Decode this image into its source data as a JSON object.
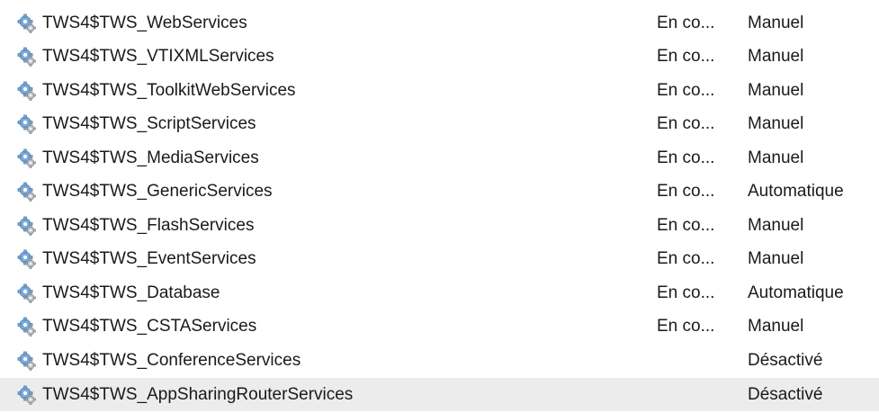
{
  "services": {
    "rows": [
      {
        "name": "TWS4$TWS_WebServices",
        "status": "En co...",
        "startup": "Manuel",
        "icon": "service-gear-icon"
      },
      {
        "name": "TWS4$TWS_VTIXMLServices",
        "status": "En co...",
        "startup": "Manuel",
        "icon": "service-gear-icon"
      },
      {
        "name": "TWS4$TWS_ToolkitWebServices",
        "status": "En co...",
        "startup": "Manuel",
        "icon": "service-gear-icon"
      },
      {
        "name": "TWS4$TWS_ScriptServices",
        "status": "En co...",
        "startup": "Manuel",
        "icon": "service-gear-icon"
      },
      {
        "name": "TWS4$TWS_MediaServices",
        "status": "En co...",
        "startup": "Manuel",
        "icon": "service-gear-icon"
      },
      {
        "name": "TWS4$TWS_GenericServices",
        "status": "En co...",
        "startup": "Automatique",
        "icon": "service-gear-icon"
      },
      {
        "name": "TWS4$TWS_FlashServices",
        "status": "En co...",
        "startup": "Manuel",
        "icon": "service-gear-icon"
      },
      {
        "name": "TWS4$TWS_EventServices",
        "status": "En co...",
        "startup": "Manuel",
        "icon": "service-gear-icon"
      },
      {
        "name": "TWS4$TWS_Database",
        "status": "En co...",
        "startup": "Automatique",
        "icon": "service-gear-icon"
      },
      {
        "name": "TWS4$TWS_CSTAServices",
        "status": "En co...",
        "startup": "Manuel",
        "icon": "service-gear-icon"
      },
      {
        "name": "TWS4$TWS_ConferenceServices",
        "status": "",
        "startup": "Désactivé",
        "icon": "service-gear-icon"
      },
      {
        "name": "TWS4$TWS_AppSharingRouterServices",
        "status": "",
        "startup": "Désactivé",
        "icon": "service-gear-icon"
      }
    ]
  },
  "colors": {
    "row_hover": "#ececec",
    "text": "#1a1a1a",
    "gear_blue": "#7aa9d6",
    "gear_grey": "#b9c1c8"
  }
}
